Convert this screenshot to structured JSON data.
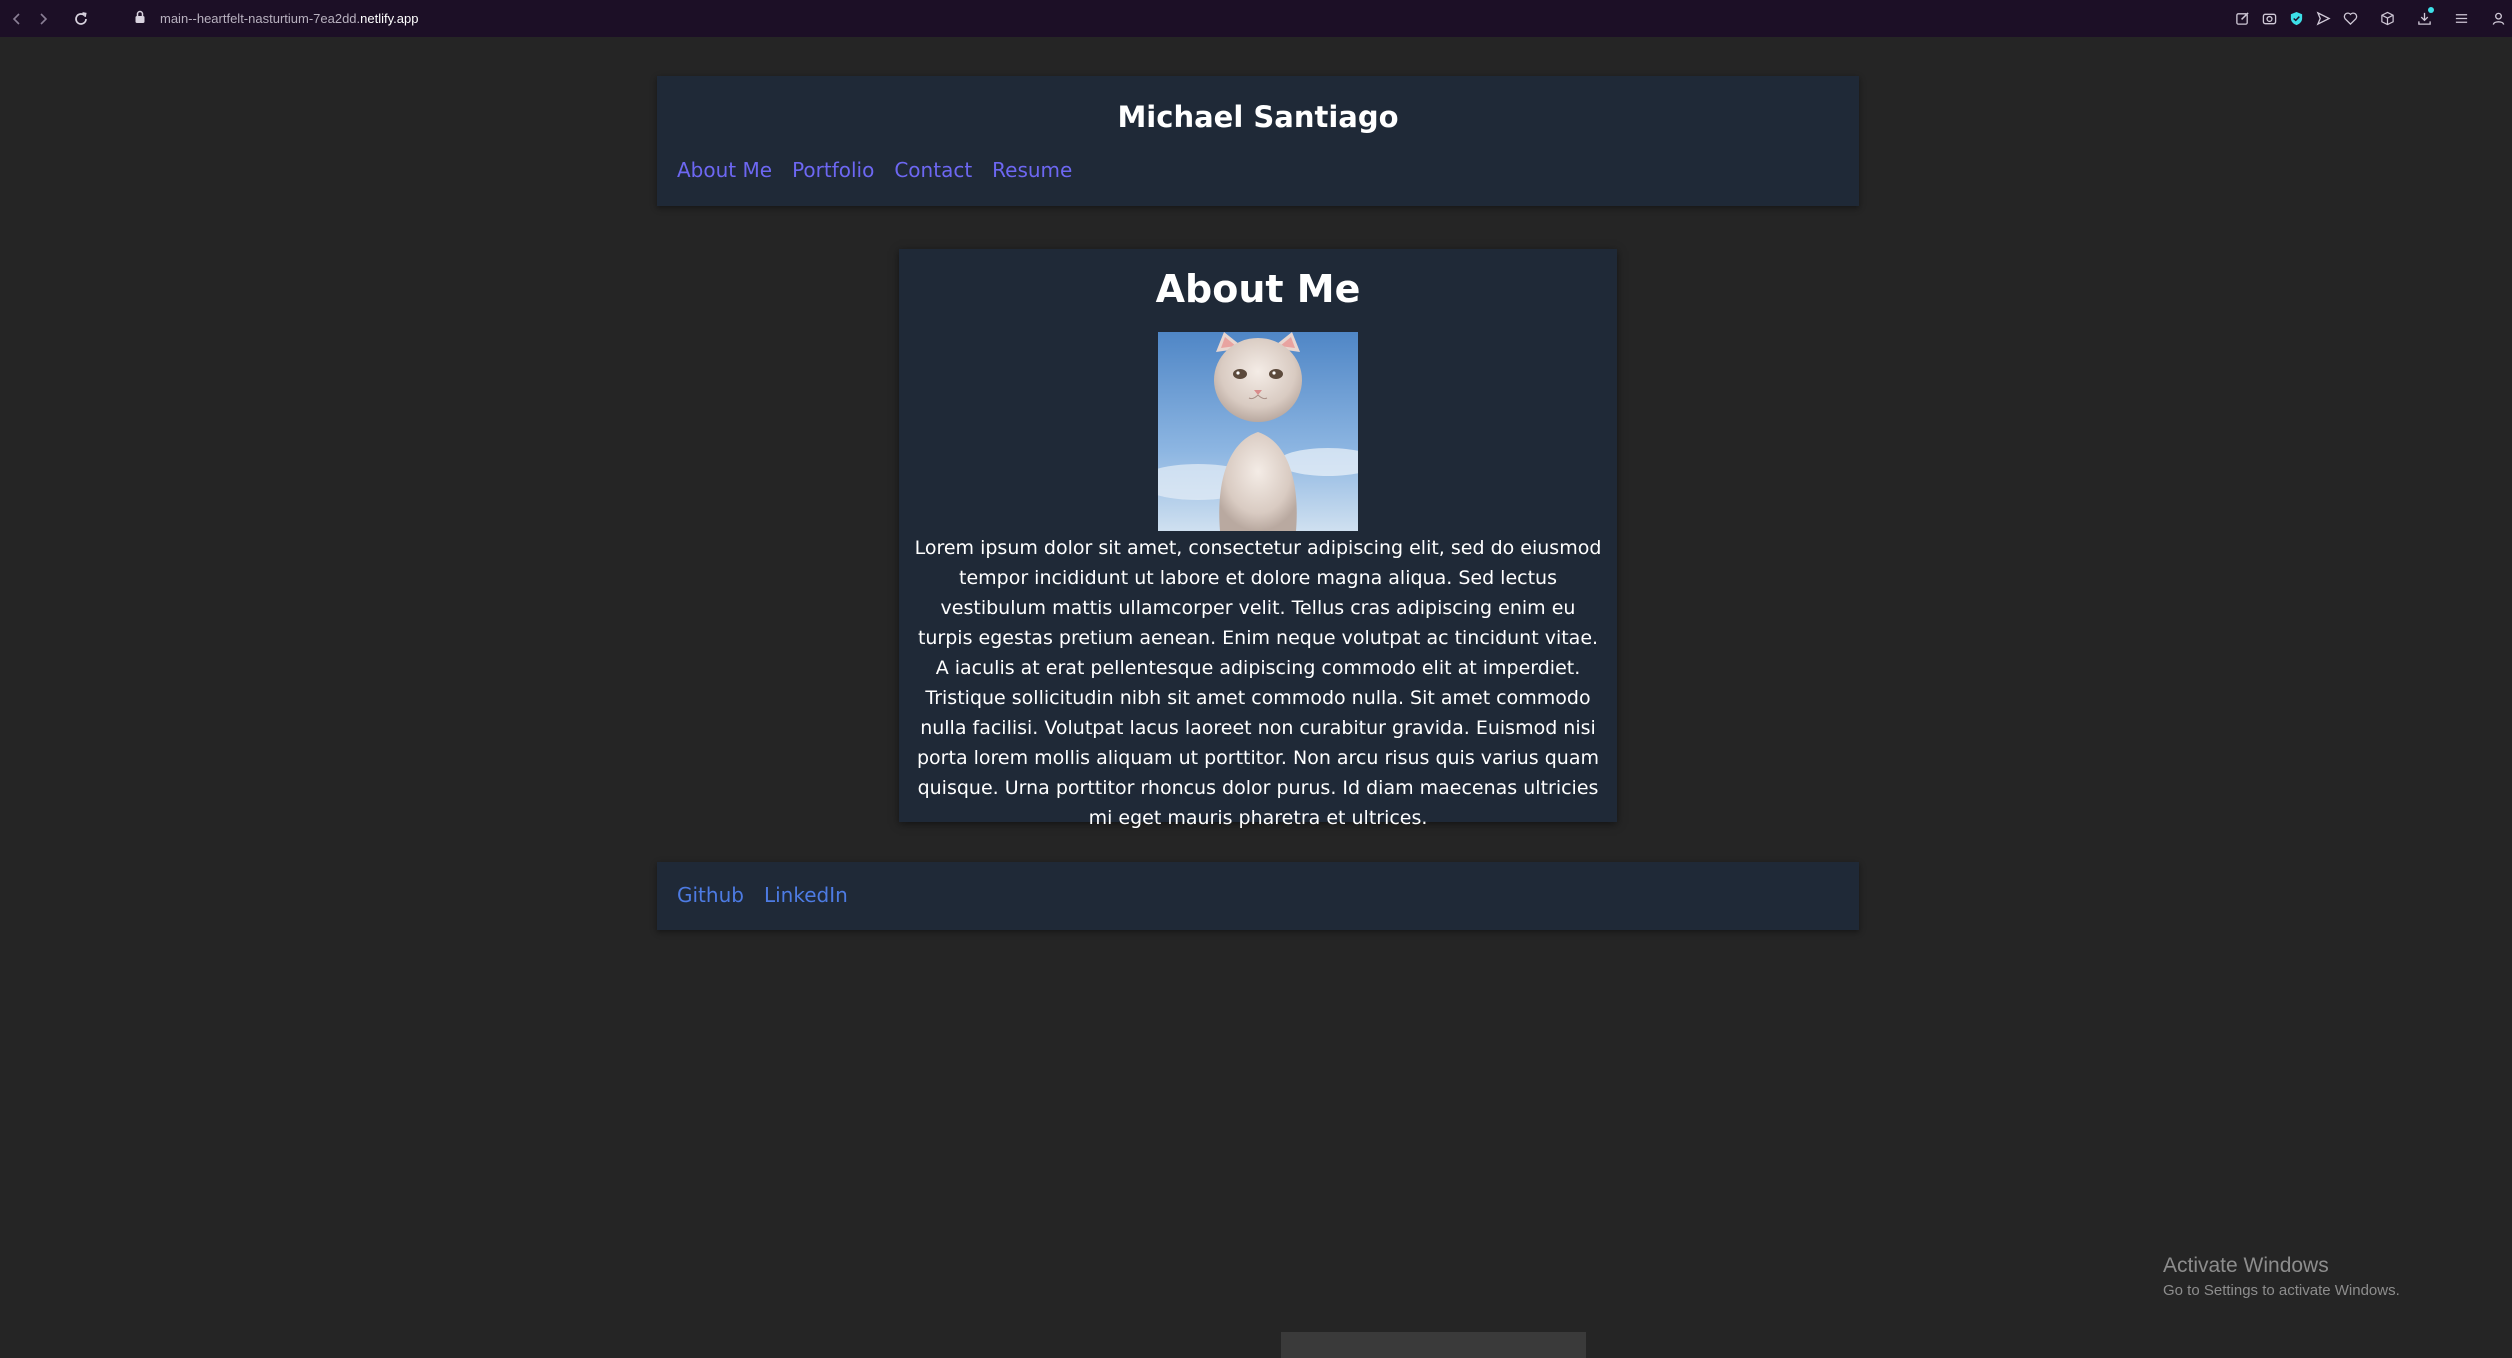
{
  "browser": {
    "url_path": "main--heartfelt-nasturtium-7ea2dd.",
    "url_host": "netlify.app",
    "icons": [
      "back-icon",
      "forward-icon",
      "reload-icon",
      "lock-icon",
      "edit-icon",
      "camera-icon",
      "shield-icon",
      "send-icon",
      "heart-icon",
      "box-icon",
      "download-icon",
      "menu-icon",
      "user-icon"
    ],
    "shield_color": "#3de0e8"
  },
  "header": {
    "title": "Michael Santiago",
    "nav": [
      {
        "label": "About Me"
      },
      {
        "label": "Portfolio"
      },
      {
        "label": "Contact"
      },
      {
        "label": "Resume"
      }
    ]
  },
  "about": {
    "heading": "About Me",
    "photo_icon": "kitten-photo",
    "text": "Lorem ipsum dolor sit amet, consectetur adipiscing elit, sed do eiusmod tempor incididunt ut labore et dolore magna aliqua. Sed lectus vestibulum mattis ullamcorper velit. Tellus cras adipiscing enim eu turpis egestas pretium aenean. Enim neque volutpat ac tincidunt vitae. A iaculis at erat pellentesque adipiscing commodo elit at imperdiet. Tristique sollicitudin nibh sit amet commodo nulla. Sit amet commodo nulla facilisi. Volutpat lacus laoreet non curabitur gravida. Euismod nisi porta lorem mollis aliquam ut porttitor. Non arcu risus quis varius quam quisque. Urna porttitor rhoncus dolor purus. Id diam maecenas ultricies mi eget mauris pharetra et ultrices."
  },
  "footer": {
    "links": [
      {
        "label": "Github"
      },
      {
        "label": "LinkedIn"
      }
    ]
  },
  "os": {
    "activate_title": "Activate Windows",
    "activate_subtitle": "Go to Settings to activate Windows."
  },
  "colors": {
    "page_background": "#252525",
    "panel_background": "#1f2937",
    "nav_link": "#6d67f2",
    "footer_link": "#4d7be3",
    "browser_bar": "#1c0f26"
  }
}
